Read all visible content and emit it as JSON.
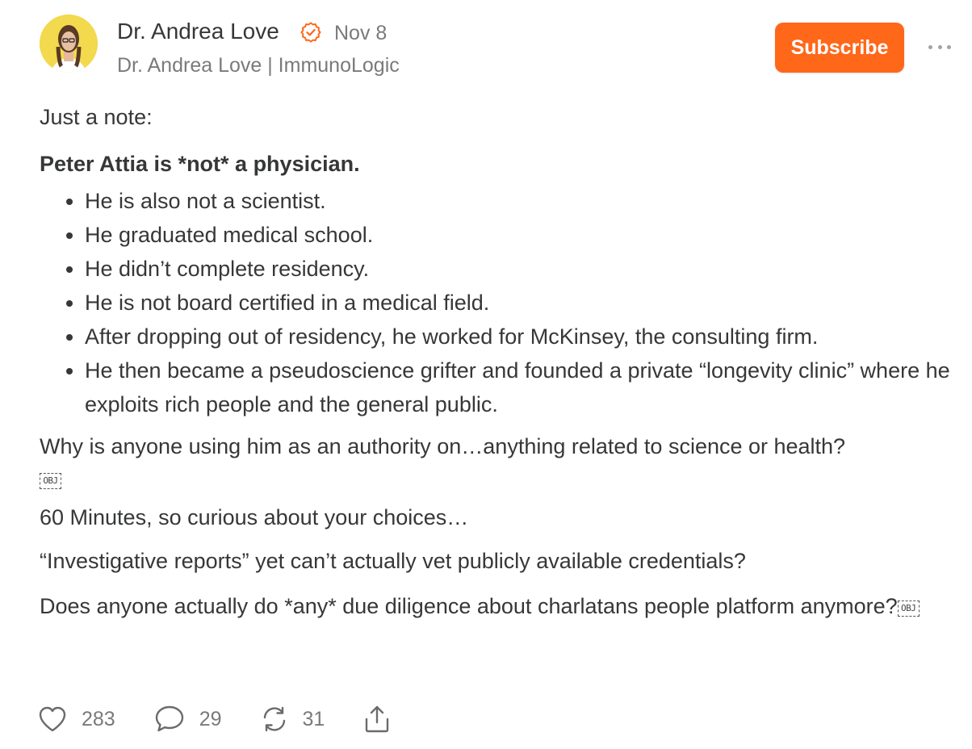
{
  "author": {
    "name": "Dr. Andrea Love",
    "date": "Nov 8",
    "publication": "Dr. Andrea Love | ImmunoLogic",
    "verified_icon": "verified-badge-icon",
    "avatar_bg": "#f2d94e"
  },
  "actions": {
    "subscribe_label": "Subscribe",
    "more_icon": "ellipsis-icon"
  },
  "colors": {
    "accent": "#ff6719",
    "text": "#363737",
    "muted": "#7a7a7a"
  },
  "post": {
    "intro": "Just a note:",
    "headline": "Peter Attia is *not* a physician.",
    "bullets": [
      "He is also not a scientist.",
      "He graduated medical school.",
      "He didn’t complete residency.",
      "He is not board certified in a medical field.",
      "After dropping out of residency, he worked for McKinsey, the consulting firm.",
      "He then became a pseudoscience grifter and founded a private “longevity clinic” where he exploits rich people and the general public."
    ],
    "question": "Why is anyone using him as an authority on…anything related to science or health?",
    "obj_placeholder": "OBJ",
    "sixty_minutes": "60 Minutes, so curious about your choices…",
    "investigative": "“Investigative reports” yet can’t actually vet publicly available credentials?",
    "due_diligence": "Does anyone actually do *any* due diligence about charlatans people platform anymore?"
  },
  "stats": {
    "likes": "283",
    "comments": "29",
    "restacks": "31"
  }
}
